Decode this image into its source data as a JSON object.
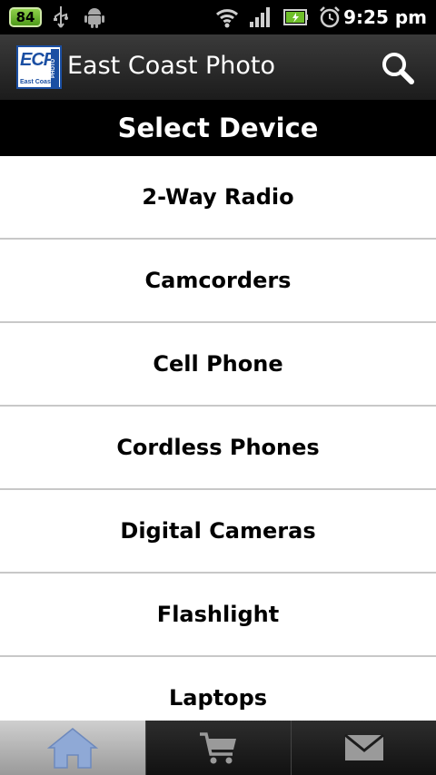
{
  "status_bar": {
    "battery_badge": "84",
    "time": "9:25 pm",
    "icons": [
      "usb-icon",
      "android-icon",
      "wifi-icon",
      "signal-icon",
      "battery-icon",
      "alarm-icon"
    ]
  },
  "app": {
    "title": "East Coast Photo",
    "logo_text": "ECP",
    "logo_subtext": "East Coast",
    "logo_side_text": "PHOTO"
  },
  "header": {
    "title": "Select Device"
  },
  "devices": [
    {
      "label": "2-Way Radio"
    },
    {
      "label": "Camcorders"
    },
    {
      "label": "Cell Phone"
    },
    {
      "label": "Cordless Phones"
    },
    {
      "label": "Digital Cameras"
    },
    {
      "label": "Flashlight"
    },
    {
      "label": "Laptops"
    }
  ],
  "tabs": [
    {
      "icon": "home-icon",
      "active": true
    },
    {
      "icon": "cart-icon",
      "active": false
    },
    {
      "icon": "mail-icon",
      "active": false
    }
  ],
  "colors": {
    "accent": "#1b4fa3",
    "battery": "#6fbf2a",
    "active_tab": "#b5b5b5"
  }
}
